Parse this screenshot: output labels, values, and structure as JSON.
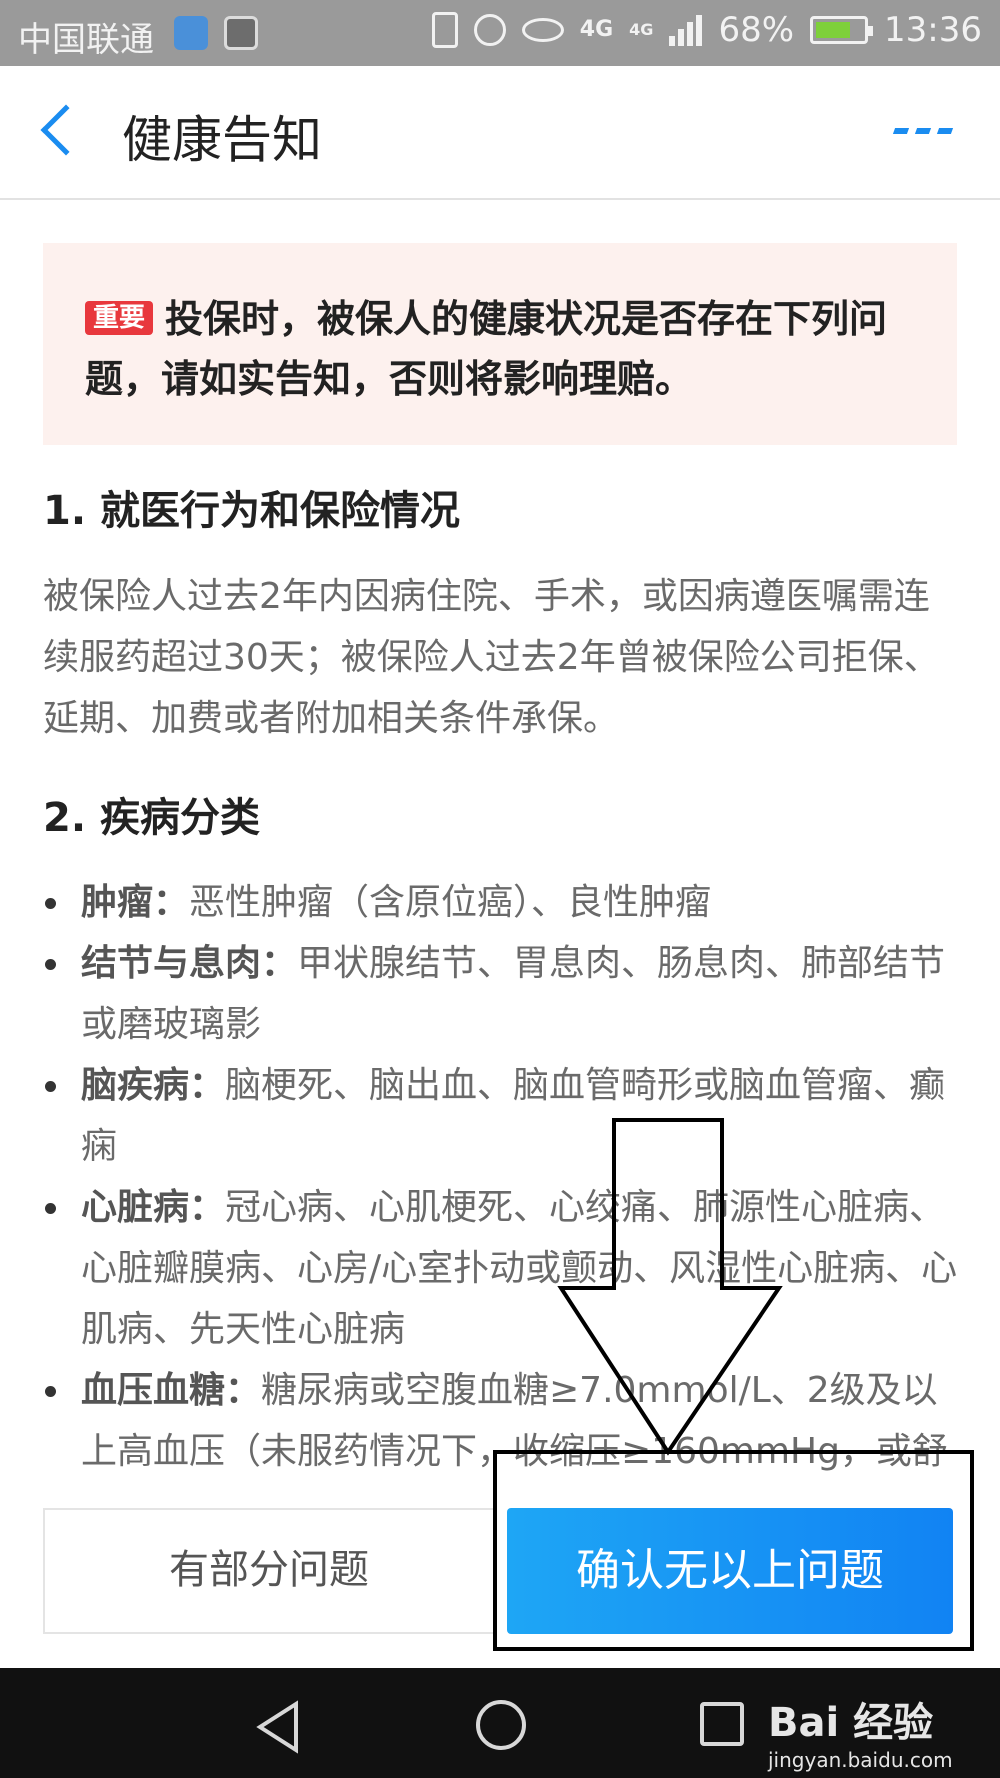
{
  "status_bar": {
    "carrier": "中国联通",
    "network": "4G",
    "network2": "4G",
    "battery": "68%",
    "time": "13:36"
  },
  "nav": {
    "title": "健康告知"
  },
  "notice": {
    "badge": "重要",
    "text": "投保时，被保人的健康状况是否存在下列问题，请如实告知，否则将影响理赔。"
  },
  "section1": {
    "title": "1. 就医行为和保险情况",
    "body": "被保险人过去2年内因病住院、手术，或因病遵医嘱需连续服药超过30天；被保险人过去2年曾被保险公司拒保、延期、加费或者附加相关条件承保。"
  },
  "section2": {
    "title": "2. 疾病分类",
    "items": [
      {
        "name": "肿瘤：",
        "desc": "恶性肿瘤（含原位癌）、良性肿瘤"
      },
      {
        "name": "结节与息肉：",
        "desc": "甲状腺结节、胃息肉、肠息肉、肺部结节或磨玻璃影"
      },
      {
        "name": "脑疾病：",
        "desc": "脑梗死、脑出血、脑血管畸形或脑血管瘤、癫痫"
      },
      {
        "name": "心脏病：",
        "desc": "冠心病、心肌梗死、心绞痛、肺源性心脏病、心脏瓣膜病、心房/心室扑动或颤动、风湿性心脏病、心肌病、先天性心脏病"
      },
      {
        "name": "血压血糖：",
        "desc": "糖尿病或空腹血糖≥7.0mmol/L、2级及以上高血压（未服药情况下，收缩压≥160mmHg，或舒"
      }
    ]
  },
  "actions": {
    "partial": "有部分问题",
    "confirm": "确认无以上问题"
  },
  "watermark": {
    "logo": "Bai 经验",
    "url": "jingyan.baidu.com"
  }
}
